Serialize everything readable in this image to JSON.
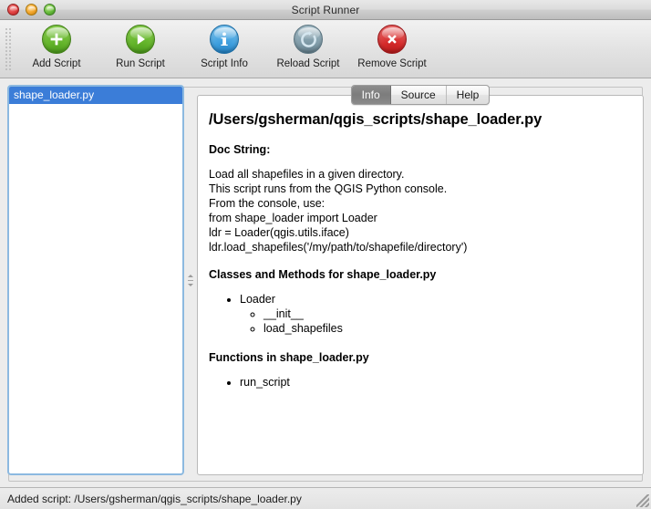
{
  "window": {
    "title": "Script Runner",
    "traffic_lights": [
      {
        "name": "close",
        "color": "#e04141"
      },
      {
        "name": "minimize",
        "color": "#f2a52a"
      },
      {
        "name": "zoom",
        "color": "#66bb3b"
      }
    ]
  },
  "toolbar": {
    "items": [
      {
        "label": "Add Script",
        "icon": "plus-circle-icon",
        "color": "#63b42a"
      },
      {
        "label": "Run Script",
        "icon": "play-circle-icon",
        "color": "#63b42a"
      },
      {
        "label": "Script Info",
        "icon": "info-circle-icon",
        "color": "#3d9ede"
      },
      {
        "label": "Reload Script",
        "icon": "reload-circle-icon",
        "color": "#7e9aa7"
      },
      {
        "label": "Remove Script",
        "icon": "remove-circle-icon",
        "color": "#d52a2a"
      }
    ]
  },
  "script_list": {
    "items": [
      {
        "label": "shape_loader.py",
        "selected": true
      }
    ],
    "selection_color": "#3b7dd8"
  },
  "tabs": [
    {
      "label": "Info",
      "active": true
    },
    {
      "label": "Source",
      "active": false
    },
    {
      "label": "Help",
      "active": false
    }
  ],
  "info": {
    "path": "/Users/gsherman/qgis_scripts/shape_loader.py",
    "docstring_heading": "Doc String:",
    "docstring_lines": [
      "Load all shapefiles in a given directory.",
      "This script runs from the QGIS Python console.",
      "From the console, use:",
      "from shape_loader import Loader",
      "ldr = Loader(qgis.utils.iface)",
      "ldr.load_shapefiles('/my/path/to/shapefile/directory')"
    ],
    "classes_heading": "Classes and Methods for shape_loader.py",
    "classes": [
      {
        "name": "Loader",
        "methods": [
          "__init__",
          "load_shapefiles"
        ]
      }
    ],
    "functions_heading": "Functions in shape_loader.py",
    "functions": [
      "run_script"
    ]
  },
  "statusbar": {
    "message": "Added script: /Users/gsherman/qgis_scripts/shape_loader.py"
  }
}
